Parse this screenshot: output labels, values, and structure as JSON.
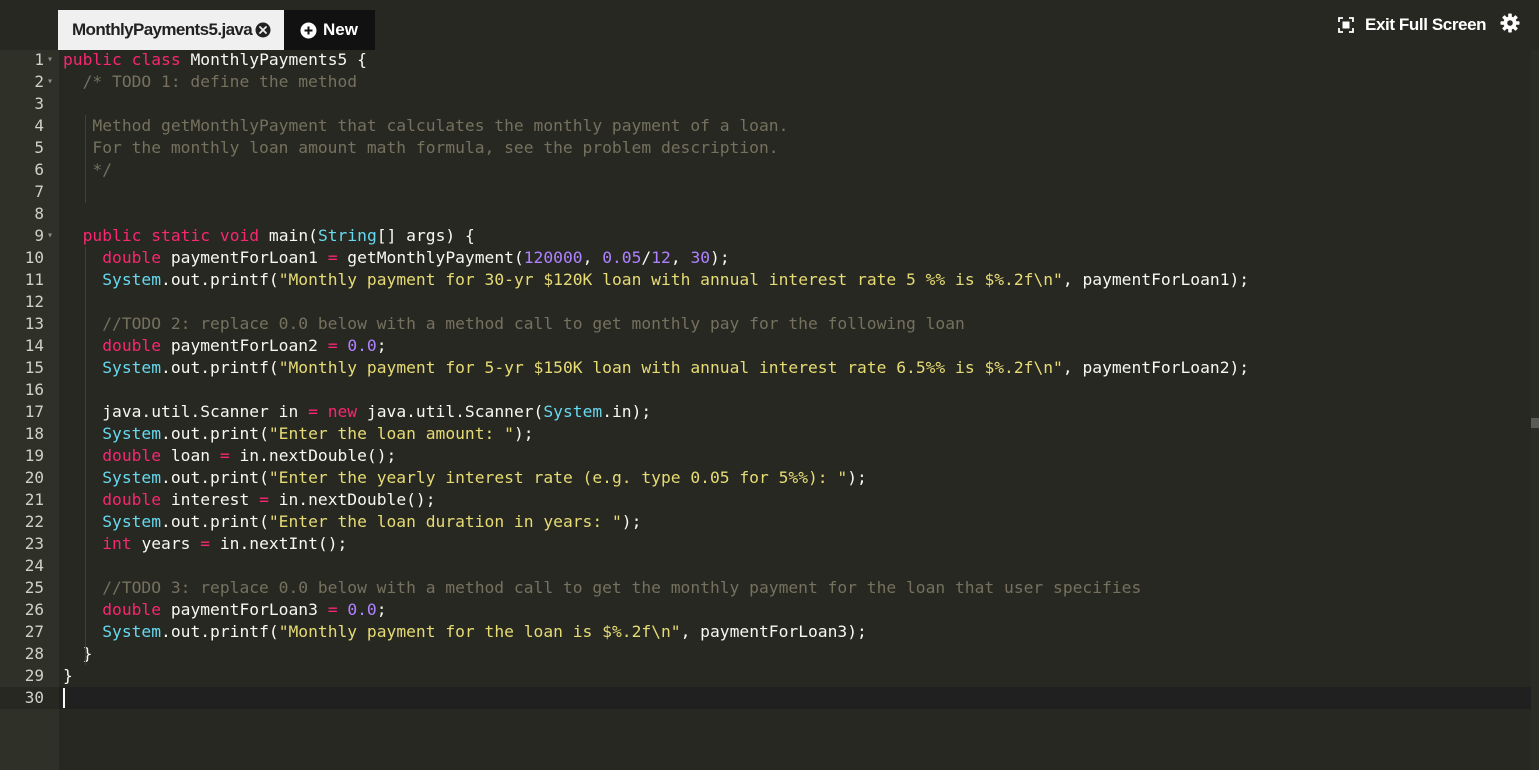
{
  "tabs": {
    "file_tab": "MonthlyPayments5.java",
    "new_tab": "New"
  },
  "toolbar": {
    "exit_full_screen": "Exit Full Screen"
  },
  "icons": {
    "close": "close-icon",
    "plus": "plus-icon",
    "fullscreen": "fullscreen-exit-icon",
    "settings": "gear-icon"
  },
  "editor": {
    "active_line": 30,
    "lines": [
      {
        "n": "1",
        "fold": true,
        "tokens": [
          [
            "k",
            "public"
          ],
          [
            "p",
            " "
          ],
          [
            "k",
            "class"
          ],
          [
            "p",
            " MonthlyPayments5 {"
          ]
        ]
      },
      {
        "n": "2",
        "fold": true,
        "tokens": [
          [
            "p",
            "  "
          ],
          [
            "c",
            "/* TODO 1: define the method"
          ]
        ]
      },
      {
        "n": "3",
        "fold": false,
        "tokens": []
      },
      {
        "n": "4",
        "fold": false,
        "tokens": [
          [
            "p",
            "   "
          ],
          [
            "c",
            "Method getMonthlyPayment that calculates the monthly payment of a loan."
          ]
        ]
      },
      {
        "n": "5",
        "fold": false,
        "tokens": [
          [
            "p",
            "   "
          ],
          [
            "c",
            "For the monthly loan amount math formula, see the problem description."
          ]
        ]
      },
      {
        "n": "6",
        "fold": false,
        "tokens": [
          [
            "p",
            "   "
          ],
          [
            "c",
            "*/"
          ]
        ]
      },
      {
        "n": "7",
        "fold": false,
        "tokens": []
      },
      {
        "n": "8",
        "fold": false,
        "tokens": []
      },
      {
        "n": "9",
        "fold": true,
        "tokens": [
          [
            "p",
            "  "
          ],
          [
            "k",
            "public"
          ],
          [
            "p",
            " "
          ],
          [
            "k",
            "static"
          ],
          [
            "p",
            " "
          ],
          [
            "k",
            "void"
          ],
          [
            "p",
            " main("
          ],
          [
            "t",
            "String"
          ],
          [
            "p",
            "[] args) {"
          ]
        ]
      },
      {
        "n": "10",
        "fold": false,
        "tokens": [
          [
            "p",
            "    "
          ],
          [
            "k",
            "double"
          ],
          [
            "p",
            " paymentForLoan1 "
          ],
          [
            "o",
            "="
          ],
          [
            "p",
            " getMonthlyPayment("
          ],
          [
            "n",
            "120000"
          ],
          [
            "p",
            ", "
          ],
          [
            "n",
            "0.05"
          ],
          [
            "p",
            "/"
          ],
          [
            "n",
            "12"
          ],
          [
            "p",
            ", "
          ],
          [
            "n",
            "30"
          ],
          [
            "p",
            ");"
          ]
        ]
      },
      {
        "n": "11",
        "fold": false,
        "tokens": [
          [
            "p",
            "    "
          ],
          [
            "t",
            "System"
          ],
          [
            "p",
            ".out.printf("
          ],
          [
            "s",
            "\"Monthly payment for 30-yr $120K loan with annual interest rate 5 %% is $%.2f\\n\""
          ],
          [
            "p",
            ", paymentForLoan1);"
          ]
        ]
      },
      {
        "n": "12",
        "fold": false,
        "tokens": []
      },
      {
        "n": "13",
        "fold": false,
        "tokens": [
          [
            "p",
            "    "
          ],
          [
            "c",
            "//TODO 2: replace 0.0 below with a method call to get monthly pay for the following loan"
          ]
        ]
      },
      {
        "n": "14",
        "fold": false,
        "tokens": [
          [
            "p",
            "    "
          ],
          [
            "k",
            "double"
          ],
          [
            "p",
            " paymentForLoan2 "
          ],
          [
            "o",
            "="
          ],
          [
            "p",
            " "
          ],
          [
            "n",
            "0.0"
          ],
          [
            "p",
            ";"
          ]
        ]
      },
      {
        "n": "15",
        "fold": false,
        "tokens": [
          [
            "p",
            "    "
          ],
          [
            "t",
            "System"
          ],
          [
            "p",
            ".out.printf("
          ],
          [
            "s",
            "\"Monthly payment for 5-yr $150K loan with annual interest rate 6.5%% is $%.2f\\n\""
          ],
          [
            "p",
            ", paymentForLoan2);"
          ]
        ]
      },
      {
        "n": "16",
        "fold": false,
        "tokens": []
      },
      {
        "n": "17",
        "fold": false,
        "tokens": [
          [
            "p",
            "    java.util.Scanner in "
          ],
          [
            "o",
            "="
          ],
          [
            "p",
            " "
          ],
          [
            "k",
            "new"
          ],
          [
            "p",
            " java.util.Scanner("
          ],
          [
            "t",
            "System"
          ],
          [
            "p",
            ".in);"
          ]
        ]
      },
      {
        "n": "18",
        "fold": false,
        "tokens": [
          [
            "p",
            "    "
          ],
          [
            "t",
            "System"
          ],
          [
            "p",
            ".out.print("
          ],
          [
            "s",
            "\"Enter the loan amount: \""
          ],
          [
            "p",
            ");"
          ]
        ]
      },
      {
        "n": "19",
        "fold": false,
        "tokens": [
          [
            "p",
            "    "
          ],
          [
            "k",
            "double"
          ],
          [
            "p",
            " loan "
          ],
          [
            "o",
            "="
          ],
          [
            "p",
            " in.nextDouble();"
          ]
        ]
      },
      {
        "n": "20",
        "fold": false,
        "tokens": [
          [
            "p",
            "    "
          ],
          [
            "t",
            "System"
          ],
          [
            "p",
            ".out.print("
          ],
          [
            "s",
            "\"Enter the yearly interest rate (e.g. type 0.05 for 5%%): \""
          ],
          [
            "p",
            ");"
          ]
        ]
      },
      {
        "n": "21",
        "fold": false,
        "tokens": [
          [
            "p",
            "    "
          ],
          [
            "k",
            "double"
          ],
          [
            "p",
            " interest "
          ],
          [
            "o",
            "="
          ],
          [
            "p",
            " in.nextDouble();"
          ]
        ]
      },
      {
        "n": "22",
        "fold": false,
        "tokens": [
          [
            "p",
            "    "
          ],
          [
            "t",
            "System"
          ],
          [
            "p",
            ".out.print("
          ],
          [
            "s",
            "\"Enter the loan duration in years: \""
          ],
          [
            "p",
            ");"
          ]
        ]
      },
      {
        "n": "23",
        "fold": false,
        "tokens": [
          [
            "p",
            "    "
          ],
          [
            "k",
            "int"
          ],
          [
            "p",
            " years "
          ],
          [
            "o",
            "="
          ],
          [
            "p",
            " in.nextInt();"
          ]
        ]
      },
      {
        "n": "24",
        "fold": false,
        "tokens": []
      },
      {
        "n": "25",
        "fold": false,
        "tokens": [
          [
            "p",
            "    "
          ],
          [
            "c",
            "//TODO 3: replace 0.0 below with a method call to get the monthly payment for the loan that user specifies"
          ]
        ]
      },
      {
        "n": "26",
        "fold": false,
        "tokens": [
          [
            "p",
            "    "
          ],
          [
            "k",
            "double"
          ],
          [
            "p",
            " paymentForLoan3 "
          ],
          [
            "o",
            "="
          ],
          [
            "p",
            " "
          ],
          [
            "n",
            "0.0"
          ],
          [
            "p",
            ";"
          ]
        ]
      },
      {
        "n": "27",
        "fold": false,
        "tokens": [
          [
            "p",
            "    "
          ],
          [
            "t",
            "System"
          ],
          [
            "p",
            ".out.printf("
          ],
          [
            "s",
            "\"Monthly payment for the loan is $%.2f\\n\""
          ],
          [
            "p",
            ", paymentForLoan3);"
          ]
        ]
      },
      {
        "n": "28",
        "fold": false,
        "tokens": [
          [
            "p",
            "  }"
          ]
        ]
      },
      {
        "n": "29",
        "fold": false,
        "tokens": [
          [
            "p",
            "}"
          ]
        ]
      },
      {
        "n": "30",
        "fold": false,
        "tokens": []
      }
    ]
  }
}
